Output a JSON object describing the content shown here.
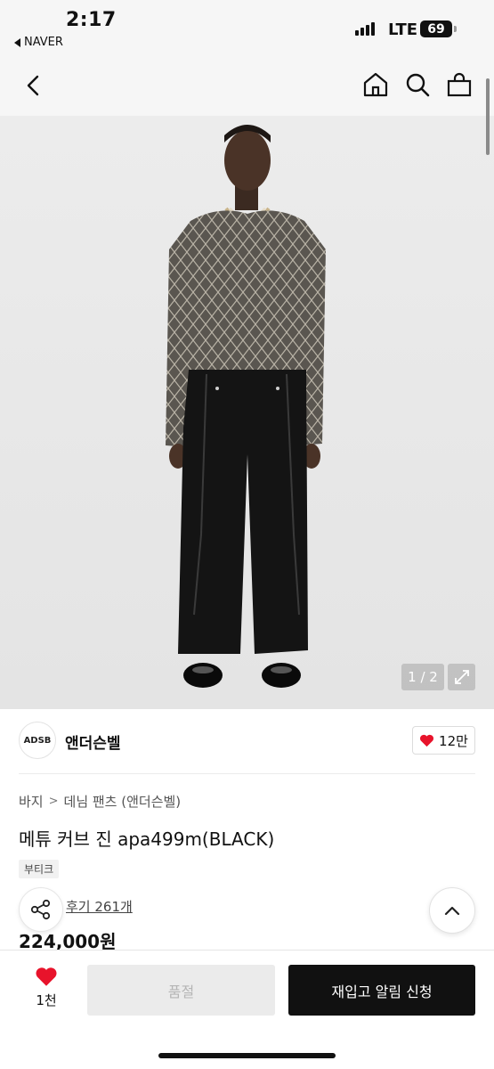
{
  "status_bar": {
    "time": "2:17",
    "back_app": "NAVER",
    "network": "LTE",
    "battery": "69"
  },
  "nav": {
    "back_icon": "chevron-left-icon",
    "icons": [
      "home-icon",
      "search-icon",
      "shopping-bag-icon"
    ]
  },
  "gallery": {
    "counter": "1 / 2",
    "expand_icon": "expand-icon"
  },
  "brand": {
    "logo_text": "ADSB",
    "name": "앤더슨벨",
    "likes": "12만"
  },
  "product": {
    "breadcrumb": [
      "바지",
      "데님 팬츠 (앤더슨벨)"
    ],
    "title": "메튜 커브 진 apa499m(BLACK)",
    "tag": "부티크",
    "reviews": "후기 261개",
    "price": "224,000원"
  },
  "bottom_bar": {
    "wish_count": "1천",
    "soldout_label": "품절",
    "restock_label": "재입고 알림 신청"
  },
  "colors": {
    "accent_heart": "#e8132b",
    "primary_button": "#111111",
    "disabled_button": "#ebebeb"
  }
}
